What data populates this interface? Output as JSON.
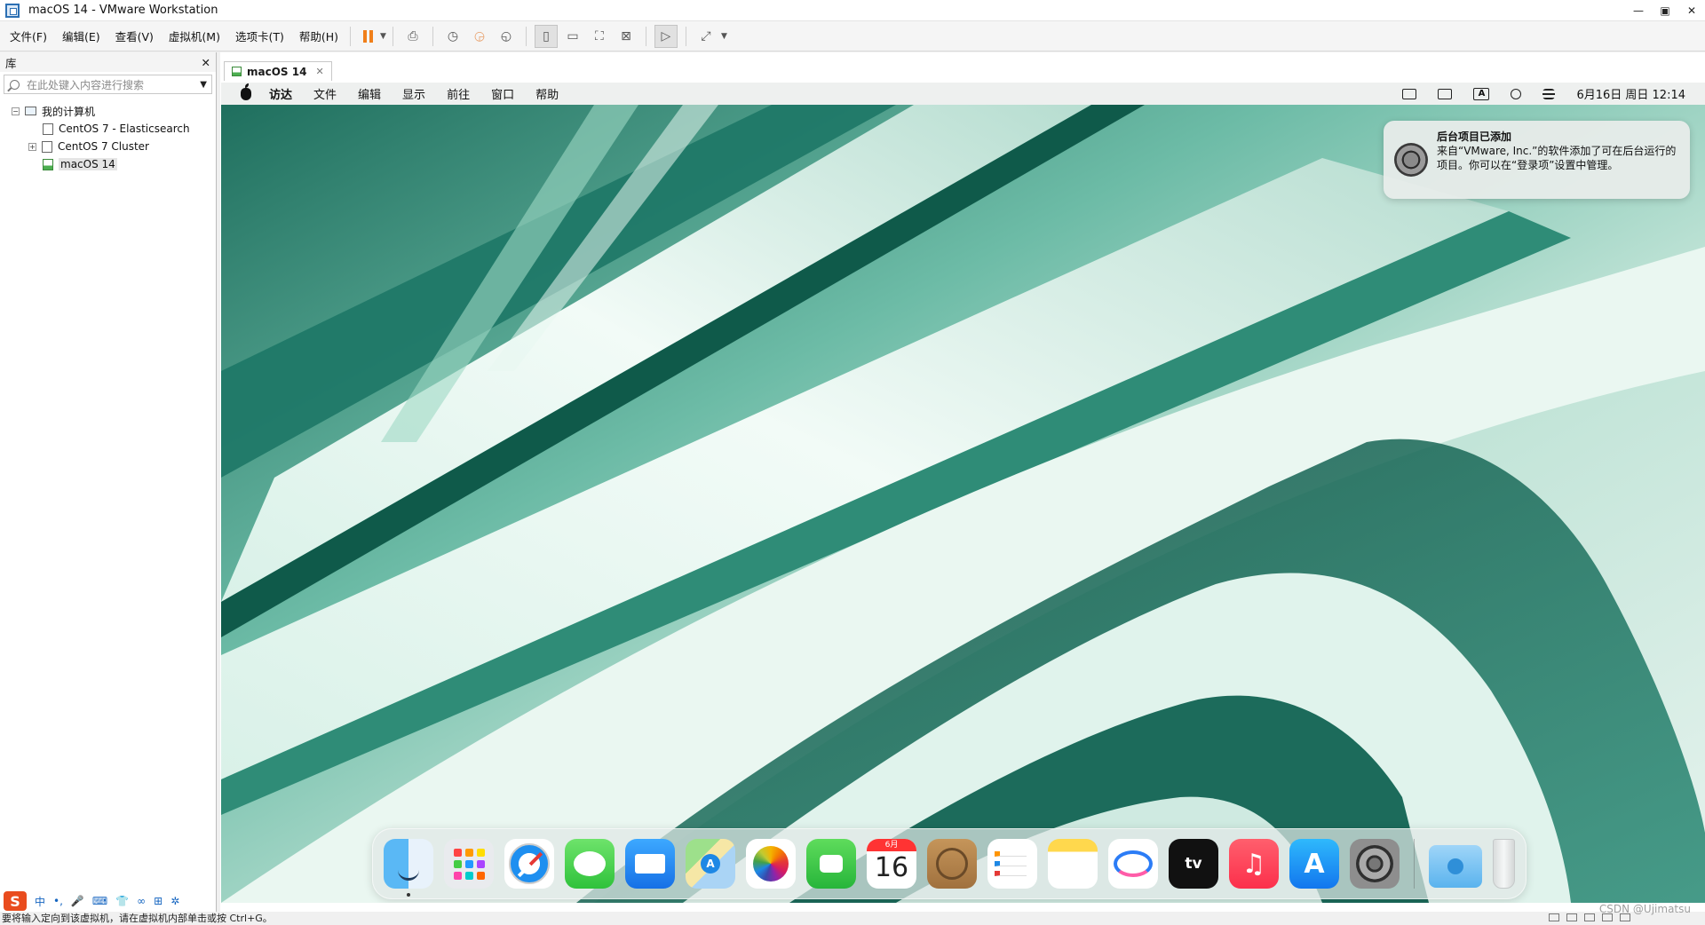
{
  "window": {
    "title": "macOS 14 - VMware Workstation",
    "controls": [
      "—",
      "▣",
      "✕"
    ]
  },
  "menu": {
    "items": [
      "文件(F)",
      "编辑(E)",
      "查看(V)",
      "虚拟机(M)",
      "选项卡(T)",
      "帮助(H)"
    ]
  },
  "toolbar": {
    "pause_color": "#f07f1a",
    "icons": [
      "pause-icon",
      "send-ctrl-alt-del-icon",
      "snapshot-icon",
      "revert-snapshot-icon",
      "snapshot-manager-icon",
      "library-view-icon",
      "thumbnail-view-icon",
      "full-screen-icon",
      "unity-icon",
      "console-icon",
      "stretch-icon"
    ]
  },
  "library": {
    "title": "库",
    "close": "✕",
    "search_placeholder": "在此处键入内容进行搜索",
    "tree": {
      "root": "我的计算机",
      "vms": [
        "CentOS 7 - Elasticsearch",
        "CentOS 7 Cluster",
        "macOS 14"
      ]
    }
  },
  "ime": {
    "logo": "S",
    "items": [
      "中",
      "•,",
      "🎤",
      "⌨",
      "👕",
      "∞",
      "⊞",
      "✲"
    ]
  },
  "statusbar": {
    "text": "要将输入定向到该虚拟机，请在虚拟机内部单击或按 Ctrl+G。",
    "watermark": "CSDN @Ujimatsu"
  },
  "vm_tab": {
    "label": "macOS 14",
    "close": "✕"
  },
  "mac": {
    "menu": [
      "访达",
      "文件",
      "编辑",
      "显示",
      "前往",
      "窗口",
      "帮助"
    ],
    "input_indicator": "A",
    "clock": "6月16日 周日  12:14",
    "notification": {
      "title": "后台项目已添加",
      "body": "来自“VMware, Inc.”的软件添加了可在后台运行的项目。你可以在“登录项”设置中管理。"
    },
    "dock": {
      "calendar_month": "6月",
      "calendar_day": "16",
      "tv_label": "tv",
      "music_glyph": "♫",
      "appstore_glyph": "A"
    }
  },
  "colors": {
    "wallpaper_dark": "#0f5a4a",
    "wallpaper_mid": "#5fb5a0",
    "wallpaper_light": "#e6f6ef"
  }
}
